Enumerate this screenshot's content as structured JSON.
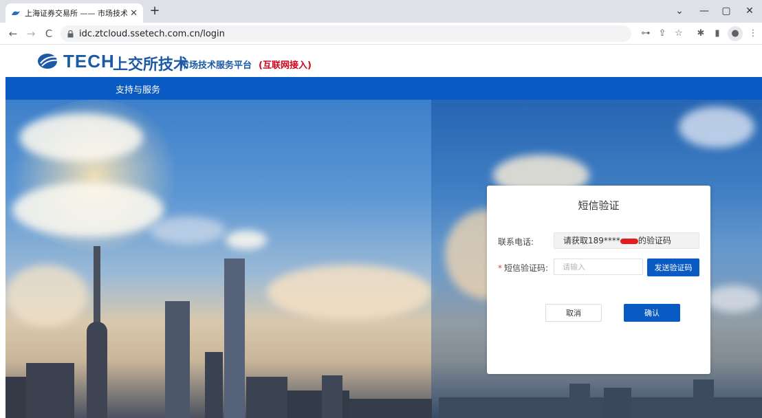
{
  "browser": {
    "tab_title": "上海证券交易所 —— 市场技术服",
    "url": "idc.ztcloud.ssetech.com.cn/login",
    "new_tab": "+",
    "tab_close": "✕",
    "win_chevron": "⌄",
    "win_minimize": "—",
    "win_restore": "▢",
    "win_close": "✕",
    "back": "←",
    "forward": "→",
    "reload": "C",
    "tools": {
      "key": "⊶",
      "share": "⇪",
      "star": "☆",
      "extensions": "✱",
      "sidepanel": "▮",
      "profile": "●",
      "menu": "⋮"
    },
    "icons": [
      "lock-icon",
      "key-icon",
      "share-icon",
      "star-icon",
      "extensions-icon",
      "side-panel-icon",
      "profile-icon",
      "menu-icon"
    ]
  },
  "header": {
    "logo_tech": "TECH",
    "logo_cn": "上交所技术",
    "platform": "市场技术服务平台",
    "access": "(互联网接入)"
  },
  "nav": {
    "item": "支持与服务"
  },
  "dialog": {
    "title": "短信验证",
    "phone_label": "联系电话:",
    "phone_prefix": "请获取189****",
    "phone_suffix": "的验证码",
    "code_label": "短信验证码:",
    "required_mark": "*",
    "code_placeholder": "请输入",
    "send_label": "发送验证码",
    "cancel_label": "取消",
    "confirm_label": "确认"
  },
  "colors": {
    "brand_blue": "#0a5ac4",
    "logo_blue": "#1b5aa6",
    "access_red": "#d0021b",
    "redaction_red": "#e01e1e"
  }
}
